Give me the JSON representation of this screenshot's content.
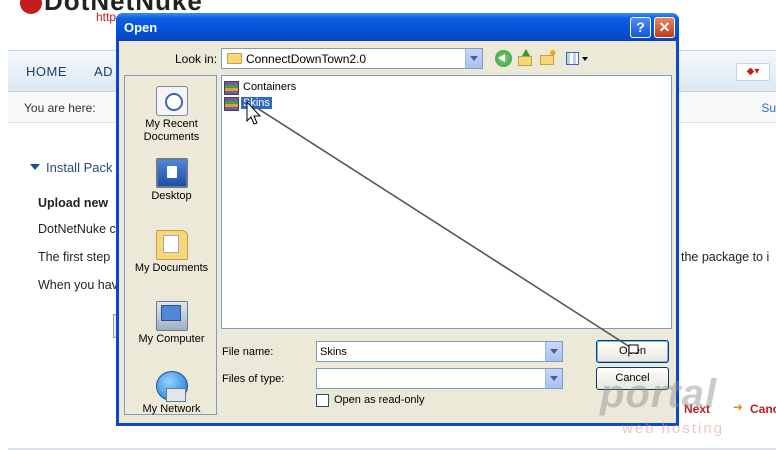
{
  "page": {
    "logo_text": "DotNetNuke",
    "logo_url": "http",
    "nav": {
      "home": "HOME",
      "admin": "AD"
    },
    "breadcrumb_label": "You are here:",
    "breadcrumb_right": "Su",
    "section_title": "Install Pack",
    "upload_heading": "Upload new",
    "line1": "DotNetNuke c",
    "line2_left": "The first step",
    "line2_right": "the package to i",
    "line3": "When you hav",
    "next_link": "Next",
    "cancel_link": "Canc"
  },
  "dialog": {
    "title": "Open",
    "help_button": "?",
    "close_button": "✕",
    "look_in_label": "Look in:",
    "look_in_value": "ConnectDownTown2.0",
    "places": [
      {
        "label": "My Recent Documents",
        "icon": "recent-documents-icon"
      },
      {
        "label": "Desktop",
        "icon": "desktop-icon"
      },
      {
        "label": "My Documents",
        "icon": "my-documents-icon"
      },
      {
        "label": "My Computer",
        "icon": "my-computer-icon"
      },
      {
        "label": "My Network",
        "icon": "my-network-icon"
      }
    ],
    "files": [
      {
        "name": "Containers",
        "icon": "archive-icon",
        "selected": false
      },
      {
        "name": "Skins",
        "icon": "archive-icon",
        "selected": true
      }
    ],
    "file_name_label": "File name:",
    "file_name_value": "Skins",
    "files_of_type_label": "Files of type:",
    "files_of_type_value": "",
    "open_button": "Open",
    "cancel_button": "Cancel",
    "read_only_label": "Open as read-only",
    "read_only_checked": false
  },
  "watermark": {
    "brand": "portal",
    "tagline": "web hosting"
  },
  "colors": {
    "title_bar": "#0552d8",
    "dialog_face": "#ece9d8",
    "selection": "#316ac5",
    "link_red": "#c21c1c"
  }
}
